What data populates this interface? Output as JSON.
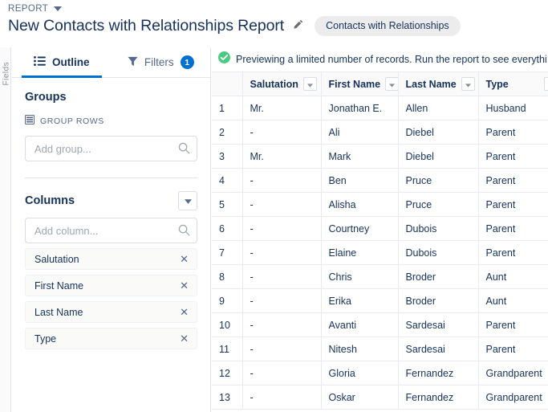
{
  "header": {
    "eyebrow": "REPORT",
    "eyebrow_icon": "chevron-down-icon",
    "title": "New Contacts with Relationships Report",
    "edit_icon": "pencil-icon",
    "report_type_pill": "Contacts with Relationships"
  },
  "rail": {
    "label": "Fields"
  },
  "panel": {
    "tabs": [
      {
        "label": "Outline",
        "icon": "outline-list-icon",
        "active": true,
        "badge": ""
      },
      {
        "label": "Filters",
        "icon": "filter-funnel-icon",
        "active": false,
        "badge": "1"
      }
    ],
    "groups": {
      "title": "Groups",
      "subhead": "GROUP ROWS",
      "subhead_icon": "rows-icon",
      "add_group_placeholder": "Add group...",
      "add_group_value": "",
      "search_icon": "search-icon"
    },
    "columns": {
      "title": "Columns",
      "menu_icon": "chevron-down-icon",
      "add_column_placeholder": "Add column...",
      "add_column_value": "",
      "search_icon": "search-icon",
      "remove_icon": "close-icon",
      "items": [
        {
          "label": "Salutation"
        },
        {
          "label": "First Name"
        },
        {
          "label": "Last Name"
        },
        {
          "label": "Type"
        }
      ]
    }
  },
  "report": {
    "banner": {
      "icon": "success-check-icon",
      "icon_color": "#4bca81",
      "text": "Previewing a limited number of records. Run the report to see everythi"
    },
    "table": {
      "rownum_header": "",
      "columns": [
        {
          "label": "Salutation",
          "menu_icon": "chevron-down-icon"
        },
        {
          "label": "First Name",
          "menu_icon": "chevron-down-icon"
        },
        {
          "label": "Last Name",
          "menu_icon": "chevron-down-icon"
        },
        {
          "label": "Type",
          "menu_icon": "chevron-down-icon"
        }
      ],
      "rows": [
        {
          "n": "1",
          "salutation": "Mr.",
          "first": "Jonathan E.",
          "last": "Allen",
          "type": "Husband"
        },
        {
          "n": "2",
          "salutation": "-",
          "first": "Ali",
          "last": "Diebel",
          "type": "Parent"
        },
        {
          "n": "3",
          "salutation": "Mr.",
          "first": "Mark",
          "last": "Diebel",
          "type": "Parent"
        },
        {
          "n": "4",
          "salutation": "-",
          "first": "Ben",
          "last": "Pruce",
          "type": "Parent"
        },
        {
          "n": "5",
          "salutation": "-",
          "first": "Alisha",
          "last": "Pruce",
          "type": "Parent"
        },
        {
          "n": "6",
          "salutation": "-",
          "first": "Courtney",
          "last": "Dubois",
          "type": "Parent"
        },
        {
          "n": "7",
          "salutation": "-",
          "first": "Elaine",
          "last": "Dubois",
          "type": "Parent"
        },
        {
          "n": "8",
          "salutation": "-",
          "first": "Chris",
          "last": "Broder",
          "type": "Aunt"
        },
        {
          "n": "9",
          "salutation": "-",
          "first": "Erika",
          "last": "Broder",
          "type": "Aunt"
        },
        {
          "n": "10",
          "salutation": "-",
          "first": "Avanti",
          "last": "Sardesai",
          "type": "Parent"
        },
        {
          "n": "11",
          "salutation": "-",
          "first": "Nitesh",
          "last": "Sardesai",
          "type": "Parent"
        },
        {
          "n": "12",
          "salutation": "-",
          "first": "Gloria",
          "last": "Fernandez",
          "type": "Grandparent"
        },
        {
          "n": "13",
          "salutation": "-",
          "first": "Oskar",
          "last": "Fernandez",
          "type": "Grandparent"
        }
      ]
    }
  },
  "colors": {
    "accent_blue": "#0070d2",
    "text_navy": "#16325c",
    "text_muted": "#54698d",
    "border": "#e0e5ee",
    "success_green": "#4bca81",
    "pill_bg": "#ececec"
  }
}
